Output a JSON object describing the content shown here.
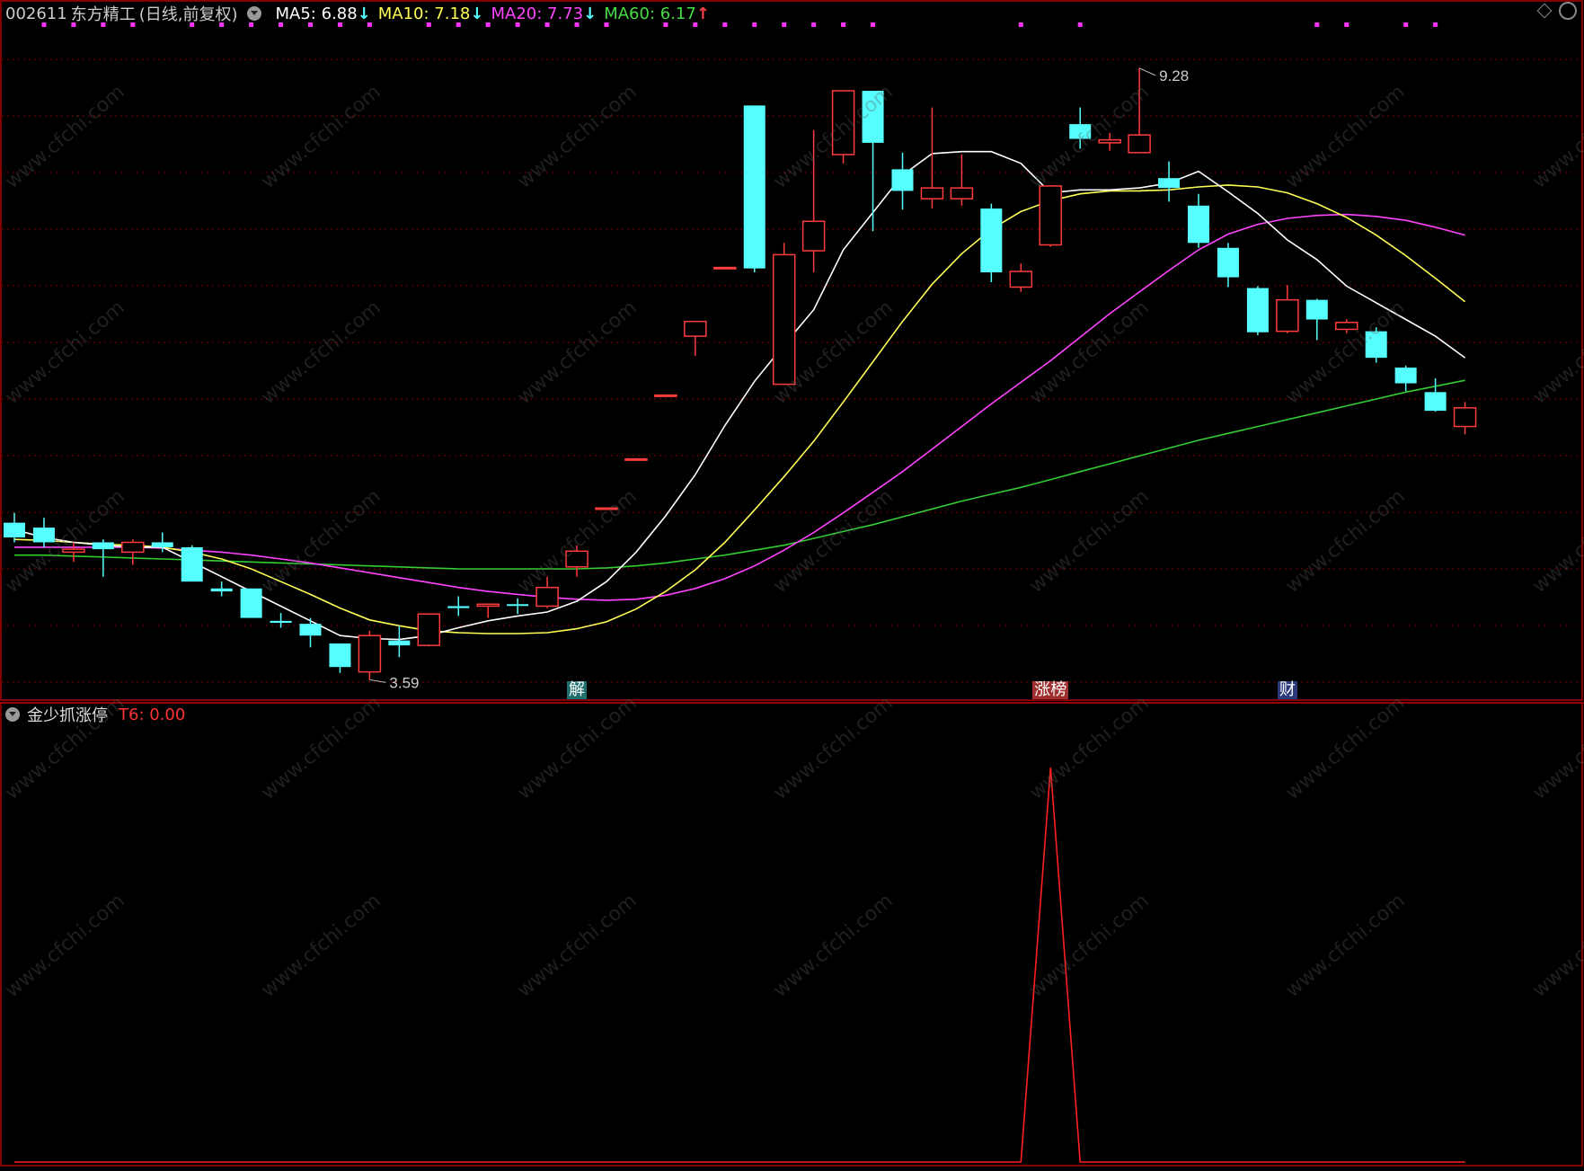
{
  "header": {
    "code": "002611",
    "name": "东方精工",
    "period": "(日线,前复权)",
    "ma": [
      {
        "label": "MA5: 6.88",
        "arrow": "↓",
        "color": "#ffffff",
        "arrow_color": "#55ffff"
      },
      {
        "label": "MA10: 7.18",
        "arrow": "↓",
        "color": "#ffff55",
        "arrow_color": "#55ffff"
      },
      {
        "label": "MA20: 7.73",
        "arrow": "↓",
        "color": "#ff44ff",
        "arrow_color": "#55ffff"
      },
      {
        "label": "MA60: 6.17",
        "arrow": "↑",
        "color": "#44dd44",
        "arrow_color": "#ff4444"
      }
    ]
  },
  "sub_header": {
    "title": "金少抓涨停",
    "value_label": "T6: 0.00"
  },
  "annotations": {
    "high_label": "9.28",
    "low_label": "3.59",
    "events": [
      {
        "text": "解",
        "index": 19,
        "bg": "#1f6f6f",
        "color": "#ffffff"
      },
      {
        "text": "涨榜",
        "index": 35,
        "bg": "#a03030",
        "color": "#ffffff"
      },
      {
        "text": "财",
        "index": 43,
        "bg": "#2a3a7a",
        "color": "#ffffff"
      }
    ]
  },
  "watermark": "www.cfchi.com",
  "colors": {
    "up": "#ff3b3b",
    "down": "#55ffff",
    "ma5": "#ffffff",
    "ma10": "#ffff55",
    "ma20": "#ff44ff",
    "ma60": "#33cc33",
    "grid": "#7a0000",
    "frame": "#b00000",
    "indicator": "#ff2020"
  },
  "chart_data": {
    "type": "candlestick",
    "ylim": [
      3.2,
      9.7
    ],
    "candles": [
      {
        "o": 4.65,
        "h": 4.75,
        "l": 4.45,
        "c": 4.5
      },
      {
        "o": 4.6,
        "h": 4.7,
        "l": 4.4,
        "c": 4.45
      },
      {
        "o": 4.35,
        "h": 4.45,
        "l": 4.25,
        "c": 4.38
      },
      {
        "o": 4.45,
        "h": 4.48,
        "l": 4.1,
        "c": 4.38
      },
      {
        "o": 4.35,
        "h": 4.48,
        "l": 4.22,
        "c": 4.45
      },
      {
        "o": 4.45,
        "h": 4.55,
        "l": 4.35,
        "c": 4.4
      },
      {
        "o": 4.4,
        "h": 4.42,
        "l": 4.05,
        "c": 4.05
      },
      {
        "o": 3.98,
        "h": 4.05,
        "l": 3.9,
        "c": 3.95
      },
      {
        "o": 3.98,
        "h": 3.98,
        "l": 3.68,
        "c": 3.68
      },
      {
        "o": 3.65,
        "h": 3.73,
        "l": 3.58,
        "c": 3.63
      },
      {
        "o": 3.62,
        "h": 3.68,
        "l": 3.38,
        "c": 3.5
      },
      {
        "o": 3.42,
        "h": 3.42,
        "l": 3.12,
        "c": 3.18
      },
      {
        "o": 3.13,
        "h": 3.55,
        "l": 3.05,
        "c": 3.5
      },
      {
        "o": 3.45,
        "h": 3.6,
        "l": 3.28,
        "c": 3.4
      },
      {
        "o": 3.4,
        "h": 3.72,
        "l": 3.39,
        "c": 3.72
      },
      {
        "o": 3.8,
        "h": 3.9,
        "l": 3.7,
        "c": 3.78
      },
      {
        "o": 3.8,
        "h": 3.82,
        "l": 3.68,
        "c": 3.82
      },
      {
        "o": 3.82,
        "h": 3.88,
        "l": 3.72,
        "c": 3.81
      },
      {
        "o": 3.8,
        "h": 4.1,
        "l": 3.78,
        "c": 3.99
      },
      {
        "o": 4.2,
        "h": 4.42,
        "l": 4.1,
        "c": 4.36
      },
      {
        "o": 4.8,
        "h": 4.8,
        "l": 4.8,
        "c": 4.8
      },
      {
        "o": 5.3,
        "h": 5.3,
        "l": 5.3,
        "c": 5.3
      },
      {
        "o": 5.95,
        "h": 5.95,
        "l": 5.95,
        "c": 5.95
      },
      {
        "o": 6.55,
        "h": 6.7,
        "l": 6.35,
        "c": 6.7
      },
      {
        "o": 7.25,
        "h": 7.25,
        "l": 7.25,
        "c": 7.25
      },
      {
        "o": 8.9,
        "h": 8.9,
        "l": 7.2,
        "c": 7.24
      },
      {
        "o": 6.06,
        "h": 7.5,
        "l": 6.06,
        "c": 7.38
      },
      {
        "o": 7.42,
        "h": 8.65,
        "l": 7.2,
        "c": 7.72
      },
      {
        "o": 8.4,
        "h": 9.05,
        "l": 8.31,
        "c": 9.05
      },
      {
        "o": 9.05,
        "h": 9.05,
        "l": 7.62,
        "c": 8.52
      },
      {
        "o": 8.25,
        "h": 8.42,
        "l": 7.84,
        "c": 8.03
      },
      {
        "o": 7.95,
        "h": 8.88,
        "l": 7.85,
        "c": 8.06
      },
      {
        "o": 7.95,
        "h": 8.4,
        "l": 7.88,
        "c": 8.06
      },
      {
        "o": 7.85,
        "h": 7.9,
        "l": 7.1,
        "c": 7.2
      },
      {
        "o": 7.05,
        "h": 7.29,
        "l": 7.0,
        "c": 7.21
      },
      {
        "o": 7.48,
        "h": 8.08,
        "l": 7.46,
        "c": 8.08
      },
      {
        "o": 8.71,
        "h": 8.88,
        "l": 8.46,
        "c": 8.56
      },
      {
        "o": 8.52,
        "h": 8.62,
        "l": 8.44,
        "c": 8.55
      },
      {
        "o": 8.42,
        "h": 9.28,
        "l": 8.42,
        "c": 8.6
      },
      {
        "o": 8.16,
        "h": 8.33,
        "l": 7.92,
        "c": 8.06
      },
      {
        "o": 7.88,
        "h": 8.0,
        "l": 7.45,
        "c": 7.5
      },
      {
        "o": 7.45,
        "h": 7.5,
        "l": 7.05,
        "c": 7.15
      },
      {
        "o": 7.04,
        "h": 7.06,
        "l": 6.56,
        "c": 6.59
      },
      {
        "o": 6.6,
        "h": 7.07,
        "l": 6.58,
        "c": 6.92
      },
      {
        "o": 6.92,
        "h": 6.93,
        "l": 6.51,
        "c": 6.72
      },
      {
        "o": 6.62,
        "h": 6.72,
        "l": 6.58,
        "c": 6.69
      },
      {
        "o": 6.6,
        "h": 6.64,
        "l": 6.28,
        "c": 6.33
      },
      {
        "o": 6.23,
        "h": 6.25,
        "l": 5.99,
        "c": 6.07
      },
      {
        "o": 5.98,
        "h": 6.12,
        "l": 5.78,
        "c": 5.79
      },
      {
        "o": 5.63,
        "h": 5.88,
        "l": 5.55,
        "c": 5.82
      }
    ],
    "ma5": [
      4.58,
      4.5,
      4.45,
      4.42,
      4.4,
      4.4,
      4.25,
      4.1,
      3.95,
      3.8,
      3.65,
      3.5,
      3.47,
      3.46,
      3.5,
      3.58,
      3.65,
      3.7,
      3.74,
      3.85,
      4.05,
      4.35,
      4.72,
      5.14,
      5.64,
      6.09,
      6.46,
      6.82,
      7.43,
      7.81,
      8.19,
      8.41,
      8.43,
      8.43,
      8.31,
      8.01,
      8.04,
      8.04,
      8.06,
      8.11,
      8.23,
      8.02,
      7.8,
      7.53,
      7.33,
      7.06,
      6.89,
      6.72,
      6.55,
      6.33
    ],
    "ma10": [
      4.48,
      4.47,
      4.45,
      4.43,
      4.42,
      4.4,
      4.35,
      4.28,
      4.18,
      4.05,
      3.92,
      3.78,
      3.66,
      3.6,
      3.55,
      3.53,
      3.52,
      3.52,
      3.53,
      3.57,
      3.64,
      3.77,
      3.95,
      4.17,
      4.45,
      4.78,
      5.12,
      5.48,
      5.88,
      6.29,
      6.7,
      7.08,
      7.39,
      7.64,
      7.82,
      7.93,
      8.0,
      8.03,
      8.03,
      8.04,
      8.07,
      8.09,
      8.07,
      8.01,
      7.9,
      7.76,
      7.58,
      7.37,
      7.14,
      6.9
    ],
    "ma20": [
      4.4,
      4.4,
      4.4,
      4.4,
      4.4,
      4.39,
      4.37,
      4.35,
      4.32,
      4.28,
      4.24,
      4.19,
      4.14,
      4.09,
      4.04,
      3.99,
      3.95,
      3.92,
      3.89,
      3.87,
      3.86,
      3.87,
      3.91,
      3.98,
      4.08,
      4.21,
      4.37,
      4.55,
      4.75,
      4.96,
      5.17,
      5.4,
      5.63,
      5.86,
      6.08,
      6.3,
      6.54,
      6.78,
      7.0,
      7.22,
      7.43,
      7.59,
      7.69,
      7.75,
      7.78,
      7.79,
      7.77,
      7.73,
      7.66,
      7.58
    ],
    "ma60": [
      4.32,
      4.32,
      4.31,
      4.3,
      4.29,
      4.28,
      4.27,
      4.26,
      4.25,
      4.24,
      4.23,
      4.22,
      4.21,
      4.2,
      4.19,
      4.18,
      4.18,
      4.18,
      4.18,
      4.18,
      4.19,
      4.21,
      4.24,
      4.28,
      4.32,
      4.37,
      4.42,
      4.49,
      4.56,
      4.63,
      4.71,
      4.79,
      4.87,
      4.94,
      5.01,
      5.09,
      5.17,
      5.25,
      5.33,
      5.41,
      5.49,
      5.56,
      5.63,
      5.7,
      5.77,
      5.84,
      5.91,
      5.98,
      6.04,
      6.1
    ],
    "signal_dots": [
      1,
      2,
      3,
      4,
      6,
      7,
      8,
      9,
      10,
      11,
      12,
      14,
      15,
      16,
      17,
      18,
      19,
      20,
      22,
      23,
      24,
      25,
      26,
      27,
      28,
      29,
      34,
      36,
      44,
      45,
      47,
      48
    ],
    "indicator": {
      "name": "T6",
      "values": [
        0,
        0,
        0,
        0,
        0,
        0,
        0,
        0,
        0,
        0,
        0,
        0,
        0,
        0,
        0,
        0,
        0,
        0,
        0,
        0,
        0,
        0,
        0,
        0,
        0,
        0,
        0,
        0,
        0,
        0,
        0,
        0,
        0,
        0,
        0,
        1,
        0,
        0,
        0,
        0,
        0,
        0,
        0,
        0,
        0,
        0,
        0,
        0,
        0,
        0
      ],
      "ylim": [
        0,
        1.08
      ]
    }
  }
}
